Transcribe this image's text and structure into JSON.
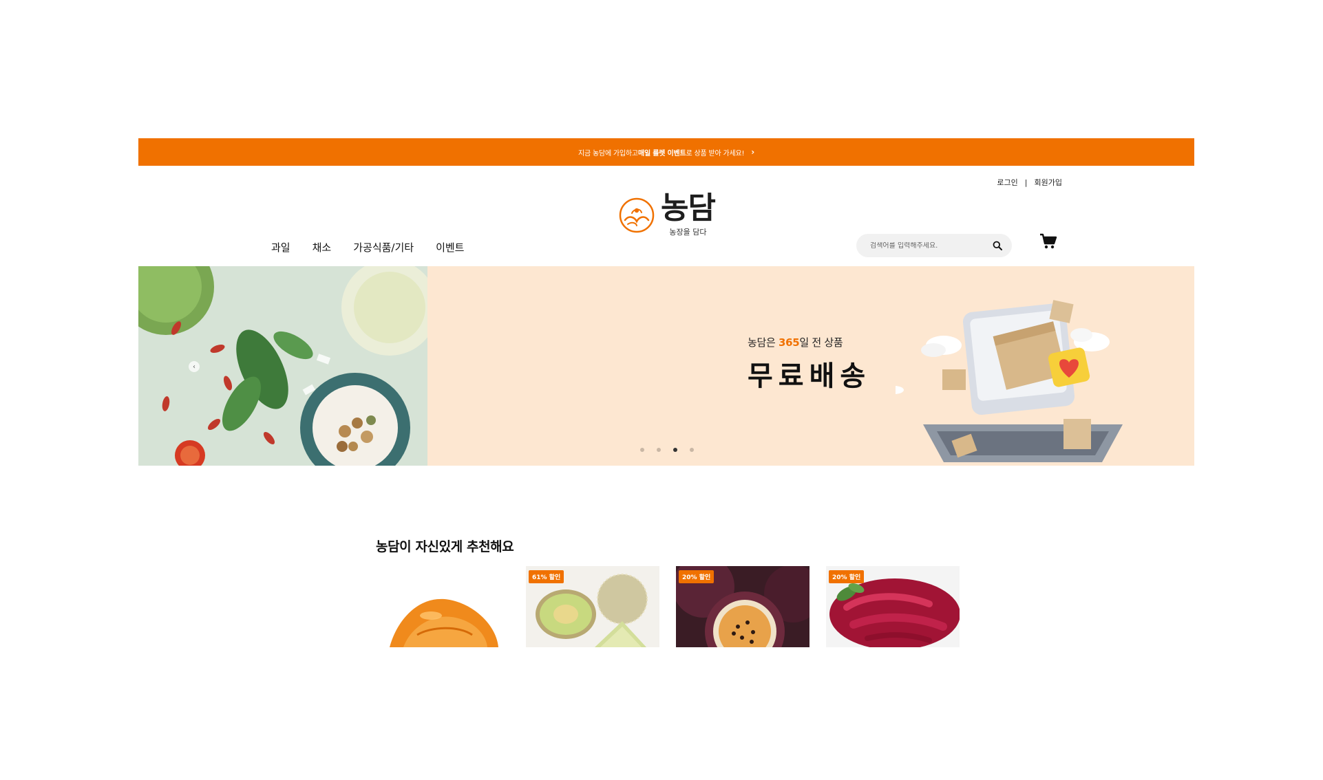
{
  "promo": {
    "text_before": "지금 농담에 가입하고 ",
    "highlight1": "매일 룰렛 이벤트",
    "text_after": "로 상품 받아 가세요!",
    "chevron": "›"
  },
  "header": {
    "login": "로그인",
    "separator": "|",
    "signup": "회원가입",
    "logo_title": "농담",
    "logo_subtitle": "농장을 담다",
    "nav": [
      "과일",
      "채소",
      "가공식품/기타",
      "이벤트"
    ],
    "search_placeholder": "검색어를 입력해주세요.",
    "search_icon": "search-icon",
    "cart_icon": "cart-icon"
  },
  "hero": {
    "line1_prefix": "농담은 ",
    "line1_accent": "365",
    "line1_suffix": "일 전 상품",
    "line2": "무료배송",
    "slides_total": 4,
    "active_slide": 3,
    "accent_color": "#f07100",
    "bg_color": "#fde7d1"
  },
  "recommend": {
    "title": "농담이 자신있게 추천해요",
    "items": [
      {
        "badge": "",
        "image": "dried-persimmon"
      },
      {
        "badge": "61% 할인",
        "image": "melon"
      },
      {
        "badge": "20% 할인",
        "image": "passion-fruit"
      },
      {
        "badge": "20% 할인",
        "image": "beet"
      }
    ]
  }
}
